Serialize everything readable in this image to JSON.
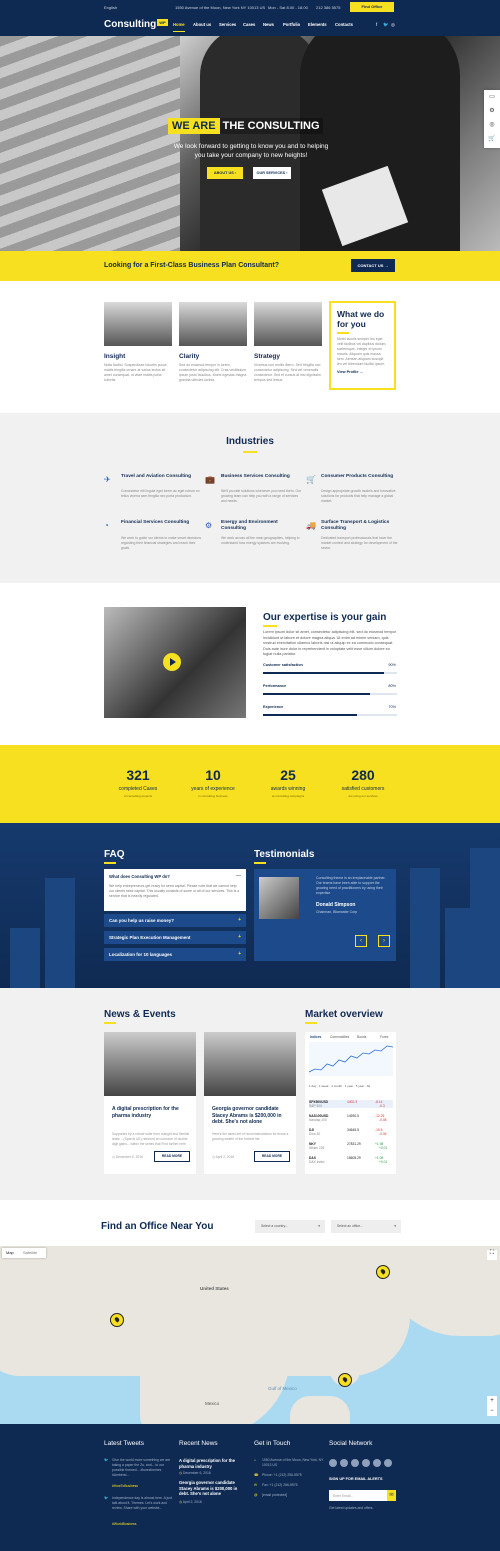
{
  "topbar": {
    "lang": "English",
    "address": "1550 Avenue of the Moon, New York NY 10013 US",
    "hours": "Mon - Sat 8.00 - 18.00",
    "phone": "212 386 5575",
    "find_office": "Find Office"
  },
  "nav": {
    "logo": "Consulting",
    "logo_badge": "WP",
    "items": [
      "Home",
      "About us",
      "Services",
      "Cases",
      "News",
      "Portfolio",
      "Elements",
      "Contacts"
    ],
    "social": [
      "f",
      "🐦",
      "◎"
    ]
  },
  "hero": {
    "title_yellow": "WE ARE",
    "title_white": "THE CONSULTING",
    "subtitle": "We look forward to getting to know you and to helping you take your company to new heights!",
    "btn_about": "ABOUT US",
    "btn_services": "OUR SERVICES"
  },
  "banner": {
    "text": "Looking for a First-Class Business Plan Consultant?",
    "button": "CONTACT US"
  },
  "services": {
    "items": [
      {
        "title": "Insight",
        "text": "Nulla facilisi. Suspendisse lobortis purus mattis fringilla ornare at varius lectus sit amet consequat, ut vitae mattis porta lobortis."
      },
      {
        "title": "Clarity",
        "text": "Sed do eiusmod tempor in lorem, consectetur adipiscing elit. Cras vestibulum ipsum justo faucibus. Morbi egestas magna gravida ultricies lacinia."
      },
      {
        "title": "Strategy",
        "text": "Vivamus non mollis libero. Sed fringilla orci consectetur adipiscing. Sed vel venenatis consectetur. Sed et cursus at nisi dignissim tempus sed lectus."
      }
    ],
    "what": {
      "title": "What we do for you",
      "text": "Morbi iaculis semper leo eget velit facilisis vel dapibus dictum, scelerisque. Integer et ipsum mauris. Aliquam quis massa sem. Aenean aliquam suscipit leo vel bibendum facilisi ipsum.",
      "link": "View Profile →"
    }
  },
  "industries": {
    "title": "Industries",
    "items": [
      {
        "icon": "✈",
        "title": "Travel and Aviation Consulting",
        "text": "Consectetur elit lingula eget lorem ac eget rutrum ex tellus viverra sem fringilla nec porta productum."
      },
      {
        "icon": "💼",
        "title": "Business Services Consulting",
        "text": "We'll provide solutions whenever you need them. Our growing team can help you with a range of services and needs."
      },
      {
        "icon": "🛒",
        "title": "Consumer Products Consulting",
        "text": "Design appropriate growth models and innovative solutions for products that help manage a global market."
      },
      {
        "icon": "◔",
        "title": "Financial Services Consulting",
        "text": "We work to guide our clients to make smart decisions regarding their financial strategies and reach their goals."
      },
      {
        "icon": "⚙",
        "title": "Energy and Environment Consulting",
        "text": "We work across all the main geographies, helping to understand how energy systems are evolving."
      },
      {
        "icon": "🚚",
        "title": "Surface Transport & Logistics Consulting",
        "text": "Dedicated transport professionals that have the market context and strategy for development of the sector."
      }
    ]
  },
  "expertise": {
    "title": "Our expertise is your gain",
    "text": "Lorem ipsum dolor sit amet, consectetur adipiscing elit, sed do eiusmod tempor incididunt ut labore et dolore magna aliqua. Ut enim ad minim veniam, quis nostrud exercitation ullamco laboris nisi ut aliquip ex ea commodo consequat. Duis aute irure dolor in reprehenderit in voluptate velit esse cillum dolore eu fugiat nulla pariatur.",
    "bars": [
      {
        "label": "Customer satisfaction",
        "value": "90%",
        "pct": 90
      },
      {
        "label": "Performance",
        "value": "80%",
        "pct": 80
      },
      {
        "label": "Experience",
        "value": "70%",
        "pct": 70
      }
    ]
  },
  "stats": [
    {
      "num": "321",
      "label": "completed Cases",
      "sub": "of consulting projects"
    },
    {
      "num": "10",
      "label": "years of experience",
      "sub": "in consulting business"
    },
    {
      "num": "25",
      "label": "awards winning",
      "sub": "at consulting campaigns"
    },
    {
      "num": "280",
      "label": "satisfied customers",
      "sub": "are using our services"
    }
  ],
  "faq": {
    "title": "FAQ",
    "open_q": "What does Consulting WP do?",
    "open_a": "We help entrepreneurs get ready for seed capital. Please note that we cannot help our clients raise capital. This usually consists of some or all of our services. This is a service that is heavily regulated.",
    "items": [
      "Can you help us raise money?",
      "Strategic Plan Execution Management",
      "Localization for 10 languages"
    ]
  },
  "testimonials": {
    "title": "Testimonials",
    "text": "Consulting theme is an irreplaceable partner. Our teams have been able to support the growing need of practitioners by using their expertise.",
    "name": "Donald Simpson",
    "role": "Chairman, Bluewater Corp"
  },
  "news": {
    "title": "News & Events",
    "items": [
      {
        "title": "A digital prescription for the pharma industry",
        "text": "Supported by a robust suite from outright and flexible lease... (Sparris UK) returned an outcome of double digit gains... within the series that Find further here",
        "date": "December 6, 2016",
        "btn": "READ MORE"
      },
      {
        "title": "Georgia governor candidate Stacey Abrams is $200,000 in debt. She's not alone",
        "text": "Here's the latest set of recommendations for those a growing wealth of the fortune list.",
        "date": "April 2, 2016",
        "btn": "READ MORE"
      }
    ]
  },
  "market": {
    "title": "Market overview",
    "tabs": [
      "Indices",
      "Commodities",
      "Bonds",
      "Forex"
    ],
    "periods": [
      "1 day",
      "1 week",
      "1 month",
      "1 year",
      "5 year",
      "All"
    ],
    "rows": [
      {
        "sym": "SPX500USD",
        "name": "S&P 500",
        "price": "4402.3",
        "chg": "-8.14",
        "pct": "-0.3",
        "up": false
      },
      {
        "sym": "NAS100USD",
        "name": "Nasdaq 100",
        "price": "14930.5",
        "chg": "-12.25",
        "pct": "-0.08",
        "up": false
      },
      {
        "sym": "DJI",
        "name": "Dow 30",
        "price": "34645.5",
        "chg": "-19.5",
        "pct": "-0.06",
        "up": false
      },
      {
        "sym": "NKY",
        "name": "Nikkei 225",
        "price": "27831.29",
        "chg": "+1.98",
        "pct": "+0.01",
        "up": true
      },
      {
        "sym": "DAX",
        "name": "DAX Index",
        "price": "15605.29",
        "chg": "+1.08",
        "pct": "+0.01",
        "up": true
      }
    ]
  },
  "office": {
    "title": "Find an Office Near You",
    "country": "Select a country...",
    "office": "Select an office...",
    "map_tabs": [
      "Map",
      "Satellite"
    ],
    "labels": [
      "United States",
      "Mexico",
      "Gulf of Mexico"
    ]
  },
  "footer": {
    "tweets_title": "Latest Tweets",
    "tweet1": "Give the world more something we are taking a paper the Zu, and... to our possible themed... #lovesthemes #Ambersi...",
    "tweet1_link": "#HowToBusiness",
    "tweet2": "Independence day is almost here. A just talk about it. Themes. Let's work and review. Share with your website...",
    "tweet2_link": "#WorldBusiness",
    "news_title": "Recent News",
    "news1": "A digital prescription for the pharma industry",
    "news1_date": "December 6, 2016",
    "news2": "Georgia governor candidate Stacey Abrams is $200,000 in debt. She's not alone",
    "news2_date": "April 2, 2016",
    "touch_title": "Get in Touch",
    "touch_addr": "1550 Avenue of the Moon, New York, NY 10013 US",
    "touch_phone": "Phone: +1 (212) 256-5575",
    "touch_fax": "Fax: +1 (212) 256-5576",
    "touch_email": "[email protected]",
    "social_title": "Social Network",
    "signup": "SIGN UP FOR EMAIL ALERTS",
    "email_ph": "Enter Email...",
    "signup_note": "Get latest updates and offers."
  },
  "colors": {
    "navy": "#0f2a52",
    "yellow": "#f6e020",
    "blue": "#1d4a8a"
  }
}
